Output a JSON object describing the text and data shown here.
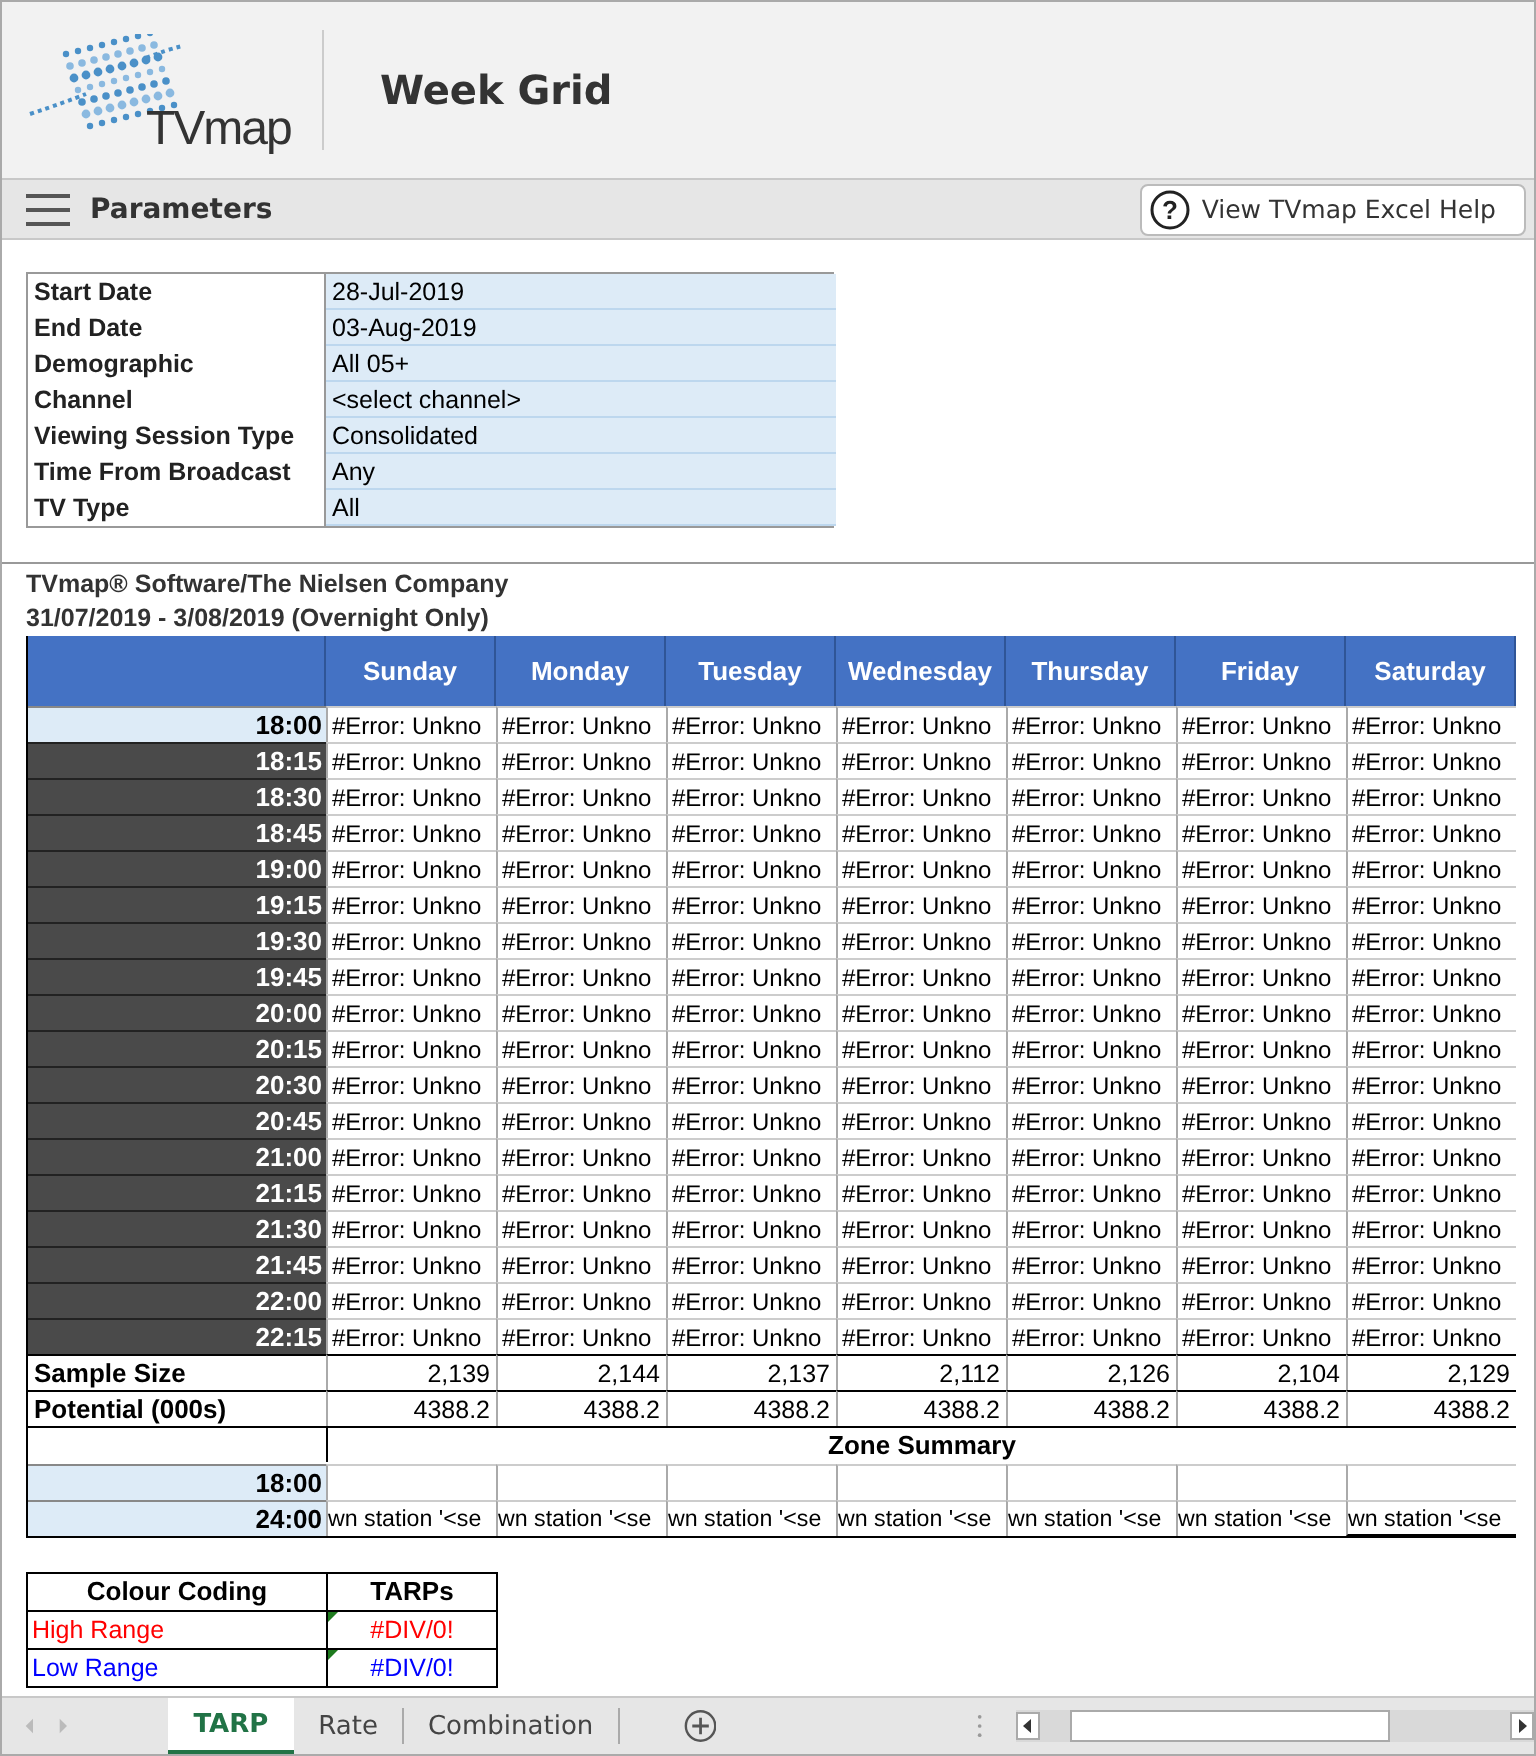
{
  "header": {
    "logo_text": "TVmap",
    "title": "Week Grid"
  },
  "parameters_bar": {
    "label": "Parameters",
    "help_icon": "?",
    "help_button": "View TVmap Excel Help"
  },
  "parameters": [
    {
      "label": "Start Date",
      "value": "28-Jul-2019"
    },
    {
      "label": "End Date",
      "value": "03-Aug-2019"
    },
    {
      "label": "Demographic",
      "value": "All 05+"
    },
    {
      "label": "Channel",
      "value": "<select channel>"
    },
    {
      "label": "Viewing Session Type",
      "value": "Consolidated"
    },
    {
      "label": "Time From Broadcast",
      "value": "Any"
    },
    {
      "label": "TV Type",
      "value": "All"
    }
  ],
  "report": {
    "source": "TVmap® Software/The Nielsen Company",
    "period": "31/07/2019 - 3/08/2019 (Overnight Only)"
  },
  "grid": {
    "columns": [
      "Sunday",
      "Monday",
      "Tuesday",
      "Wednesday",
      "Thursday",
      "Friday",
      "Saturday"
    ],
    "rows": [
      {
        "time": "18:00",
        "highlighted": true,
        "cells": [
          "#Error: Unkno",
          "#Error: Unkno",
          "#Error: Unkno",
          "#Error: Unkno",
          "#Error: Unkno",
          "#Error: Unkno",
          "#Error: Unkno"
        ]
      },
      {
        "time": "18:15",
        "highlighted": false,
        "cells": [
          "#Error: Unkno",
          "#Error: Unkno",
          "#Error: Unkno",
          "#Error: Unkno",
          "#Error: Unkno",
          "#Error: Unkno",
          "#Error: Unkno"
        ]
      },
      {
        "time": "18:30",
        "highlighted": false,
        "cells": [
          "#Error: Unkno",
          "#Error: Unkno",
          "#Error: Unkno",
          "#Error: Unkno",
          "#Error: Unkno",
          "#Error: Unkno",
          "#Error: Unkno"
        ]
      },
      {
        "time": "18:45",
        "highlighted": false,
        "cells": [
          "#Error: Unkno",
          "#Error: Unkno",
          "#Error: Unkno",
          "#Error: Unkno",
          "#Error: Unkno",
          "#Error: Unkno",
          "#Error: Unkno"
        ]
      },
      {
        "time": "19:00",
        "highlighted": false,
        "cells": [
          "#Error: Unkno",
          "#Error: Unkno",
          "#Error: Unkno",
          "#Error: Unkno",
          "#Error: Unkno",
          "#Error: Unkno",
          "#Error: Unkno"
        ]
      },
      {
        "time": "19:15",
        "highlighted": false,
        "cells": [
          "#Error: Unkno",
          "#Error: Unkno",
          "#Error: Unkno",
          "#Error: Unkno",
          "#Error: Unkno",
          "#Error: Unkno",
          "#Error: Unkno"
        ]
      },
      {
        "time": "19:30",
        "highlighted": false,
        "cells": [
          "#Error: Unkno",
          "#Error: Unkno",
          "#Error: Unkno",
          "#Error: Unkno",
          "#Error: Unkno",
          "#Error: Unkno",
          "#Error: Unkno"
        ]
      },
      {
        "time": "19:45",
        "highlighted": false,
        "cells": [
          "#Error: Unkno",
          "#Error: Unkno",
          "#Error: Unkno",
          "#Error: Unkno",
          "#Error: Unkno",
          "#Error: Unkno",
          "#Error: Unkno"
        ]
      },
      {
        "time": "20:00",
        "highlighted": false,
        "cells": [
          "#Error: Unkno",
          "#Error: Unkno",
          "#Error: Unkno",
          "#Error: Unkno",
          "#Error: Unkno",
          "#Error: Unkno",
          "#Error: Unkno"
        ]
      },
      {
        "time": "20:15",
        "highlighted": false,
        "cells": [
          "#Error: Unkno",
          "#Error: Unkno",
          "#Error: Unkno",
          "#Error: Unkno",
          "#Error: Unkno",
          "#Error: Unkno",
          "#Error: Unkno"
        ]
      },
      {
        "time": "20:30",
        "highlighted": false,
        "cells": [
          "#Error: Unkno",
          "#Error: Unkno",
          "#Error: Unkno",
          "#Error: Unkno",
          "#Error: Unkno",
          "#Error: Unkno",
          "#Error: Unkno"
        ]
      },
      {
        "time": "20:45",
        "highlighted": false,
        "cells": [
          "#Error: Unkno",
          "#Error: Unkno",
          "#Error: Unkno",
          "#Error: Unkno",
          "#Error: Unkno",
          "#Error: Unkno",
          "#Error: Unkno"
        ]
      },
      {
        "time": "21:00",
        "highlighted": false,
        "cells": [
          "#Error: Unkno",
          "#Error: Unkno",
          "#Error: Unkno",
          "#Error: Unkno",
          "#Error: Unkno",
          "#Error: Unkno",
          "#Error: Unkno"
        ]
      },
      {
        "time": "21:15",
        "highlighted": false,
        "cells": [
          "#Error: Unkno",
          "#Error: Unkno",
          "#Error: Unkno",
          "#Error: Unkno",
          "#Error: Unkno",
          "#Error: Unkno",
          "#Error: Unkno"
        ]
      },
      {
        "time": "21:30",
        "highlighted": false,
        "cells": [
          "#Error: Unkno",
          "#Error: Unkno",
          "#Error: Unkno",
          "#Error: Unkno",
          "#Error: Unkno",
          "#Error: Unkno",
          "#Error: Unkno"
        ]
      },
      {
        "time": "21:45",
        "highlighted": false,
        "cells": [
          "#Error: Unkno",
          "#Error: Unkno",
          "#Error: Unkno",
          "#Error: Unkno",
          "#Error: Unkno",
          "#Error: Unkno",
          "#Error: Unkno"
        ]
      },
      {
        "time": "22:00",
        "highlighted": false,
        "cells": [
          "#Error: Unkno",
          "#Error: Unkno",
          "#Error: Unkno",
          "#Error: Unkno",
          "#Error: Unkno",
          "#Error: Unkno",
          "#Error: Unkno"
        ]
      },
      {
        "time": "22:15",
        "highlighted": false,
        "cells": [
          "#Error: Unkno",
          "#Error: Unkno",
          "#Error: Unkno",
          "#Error: Unkno",
          "#Error: Unkno",
          "#Error: Unkno",
          "#Error: Unkno"
        ]
      }
    ],
    "totals": [
      {
        "label": "Sample Size",
        "values": [
          "2,139",
          "2,144",
          "2,137",
          "2,112",
          "2,126",
          "2,104",
          "2,129"
        ]
      },
      {
        "label": "Potential (000s)",
        "values": [
          "4388.2",
          "4388.2",
          "4388.2",
          "4388.2",
          "4388.2",
          "4388.2",
          "4388.2"
        ]
      }
    ],
    "zone_summary": {
      "title": "Zone Summary",
      "rows": [
        {
          "time": "18:00",
          "cells": []
        },
        {
          "time": "24:00",
          "cells": [
            "wn station '<se",
            "wn station '<se",
            "wn station '<se",
            "wn station '<se",
            "wn station '<se",
            "wn station '<se",
            "wn station '<se"
          ]
        }
      ]
    }
  },
  "colour_coding": {
    "columns": [
      "Colour Coding",
      "TARPs"
    ],
    "rows": [
      {
        "label": "High Range",
        "value": "#DIV/0!",
        "color": "#ff0000"
      },
      {
        "label": "Low Range",
        "value": "#DIV/0!",
        "color": "#0000ff"
      }
    ]
  },
  "sheet_tabs": [
    {
      "label": "TARP",
      "selected": true
    },
    {
      "label": "Rate",
      "selected": false
    },
    {
      "label": "Combination",
      "selected": false
    }
  ]
}
